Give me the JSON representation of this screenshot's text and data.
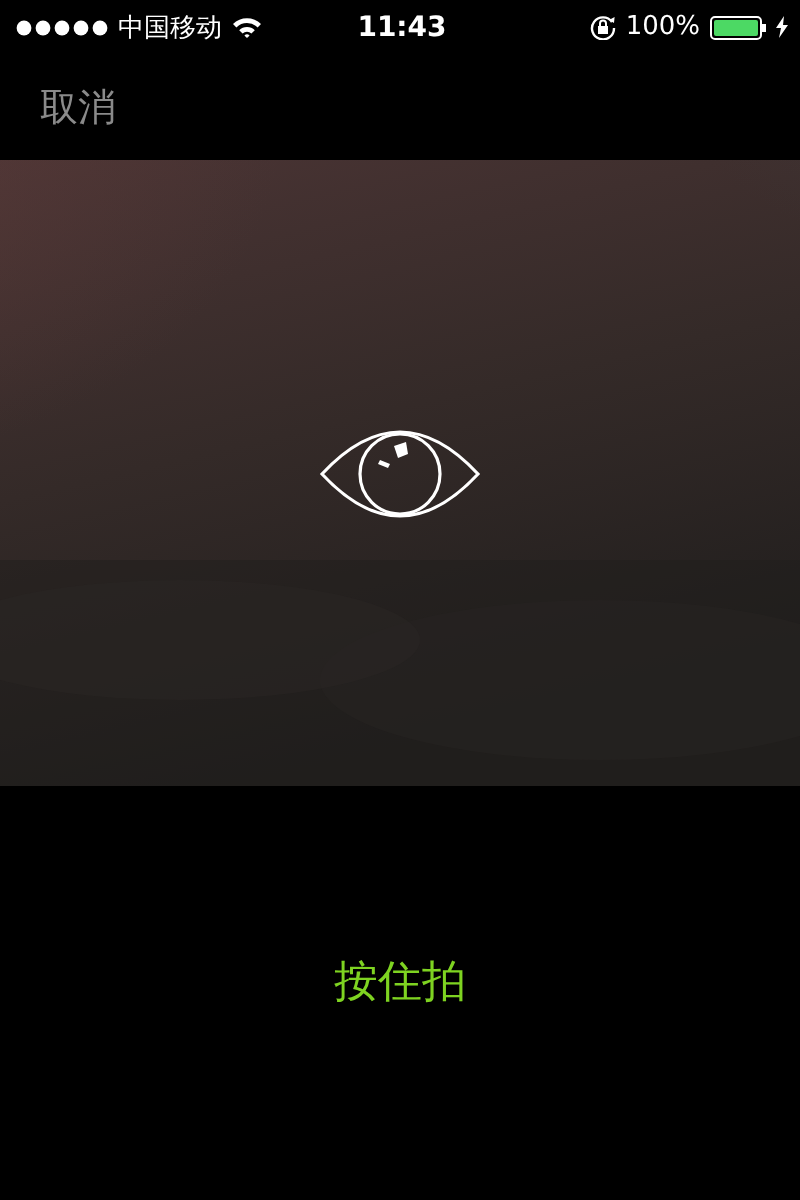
{
  "status_bar": {
    "carrier": "中国移动",
    "time": "11:43",
    "battery": "100%"
  },
  "nav": {
    "cancel": "取消"
  },
  "record_button": {
    "label": "按住拍"
  }
}
